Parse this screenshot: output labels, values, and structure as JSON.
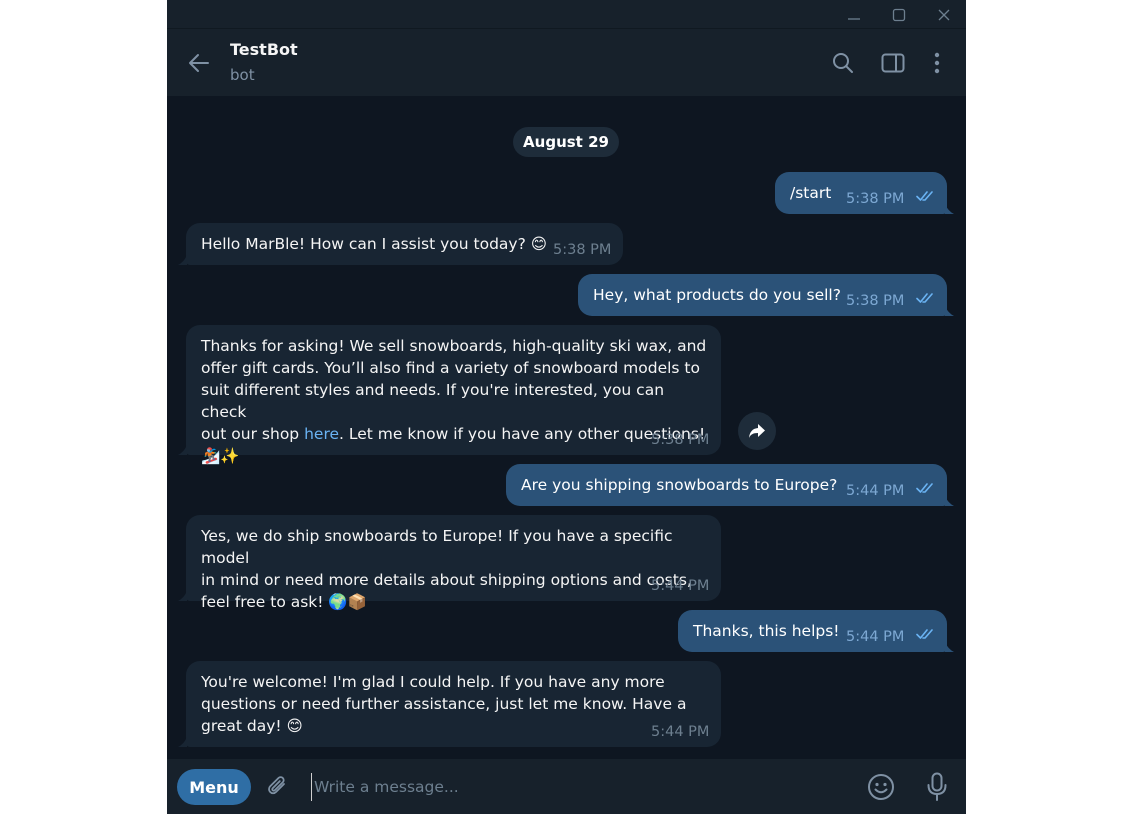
{
  "header": {
    "title": "TestBot",
    "status": "bot"
  },
  "date_separator": "August 29",
  "messages": [
    {
      "direction": "out",
      "text": "/start",
      "time": "5:38 PM",
      "read": true
    },
    {
      "direction": "in",
      "text": "Hello MarBle! How can I assist you today? 😊",
      "time": "5:38 PM"
    },
    {
      "direction": "out",
      "text": "Hey, what products do you sell?",
      "time": "5:38 PM",
      "read": true
    },
    {
      "direction": "in",
      "lines": [
        "Thanks for asking! We sell snowboards, high-quality ski wax, and",
        "offer gift cards. You’ll also find a variety of snowboard models to",
        "suit different styles and needs. If you're interested, you can check",
        "out our shop ",
        "here",
        ". Let me know if you have any other questions!",
        "🏂✨"
      ],
      "time": "5:38 PM"
    },
    {
      "direction": "out",
      "text": "Are you shipping snowboards to Europe?",
      "time": "5:44 PM",
      "read": true
    },
    {
      "direction": "in",
      "lines": [
        "Yes, we do ship snowboards to Europe! If you have a specific model",
        "in mind or need more details about shipping options and costs,",
        "feel free to ask! 🌍📦"
      ],
      "time": "5:44 PM"
    },
    {
      "direction": "out",
      "text": "Thanks, this helps!",
      "time": "5:44 PM",
      "read": true
    },
    {
      "direction": "in",
      "lines": [
        "You're welcome! I'm glad I could help. If you have any more",
        "questions or need further assistance, just let me know. Have a",
        "great day! 😊"
      ],
      "time": "5:44 PM"
    }
  ],
  "composer": {
    "menu_label": "Menu",
    "placeholder": "Write a message..."
  },
  "icons": {
    "window": [
      "minimize-icon",
      "maximize-icon",
      "close-icon"
    ],
    "header": [
      "back-arrow-icon",
      "search-icon",
      "sidebar-toggle-icon",
      "more-vertical-icon"
    ],
    "message": [
      "double-check-icon",
      "share-icon"
    ],
    "composer": [
      "paperclip-icon",
      "emoji-icon",
      "microphone-icon"
    ]
  },
  "colors": {
    "background": "#0e1621",
    "panel": "#17212b",
    "incoming_bubble": "#182533",
    "outgoing_bubble": "#2b5278",
    "link": "#6ab3f3",
    "menu_button": "#2f6ea5"
  }
}
